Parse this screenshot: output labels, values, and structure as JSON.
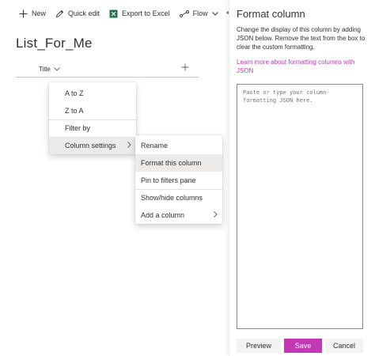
{
  "command_bar": {
    "new_label": "New",
    "quick_edit_label": "Quick edit",
    "export_label": "Export to Excel",
    "flow_label": "Flow",
    "icons": [
      "plus-icon",
      "pencil-icon",
      "excel-icon",
      "flow-icon",
      "chevron-down-icon",
      "more-icon"
    ]
  },
  "list": {
    "title": "List_For_Me",
    "column_header": "Title"
  },
  "column_menu": {
    "items": [
      {
        "label": "A to Z"
      },
      {
        "label": "Z to A"
      },
      {
        "label": "Filter by"
      },
      {
        "label": "Column settings",
        "highlighted": true,
        "has_submenu": true
      }
    ]
  },
  "settings_submenu": {
    "items": [
      {
        "label": "Rename"
      },
      {
        "label": "Format this column",
        "highlighted": true
      },
      {
        "label": "Pin to filters pane"
      },
      {
        "label": "Show/hide columns"
      },
      {
        "label": "Add a column",
        "has_submenu": true
      }
    ]
  },
  "panel": {
    "title": "Format column",
    "description": "Change the display of this column by adding JSON below. Remove the text from the box to clear the custom formatting.",
    "link": "Learn more about formatting columns with JSON",
    "json_placeholder": "Paste or type your column-formatting JSON here.",
    "json_value": "",
    "buttons": {
      "preview": "Preview",
      "save": "Save",
      "cancel": "Cancel"
    }
  },
  "colors": {
    "accent": "#c239b3",
    "text": "#323130",
    "highlight": "#edebe9",
    "excel_green": "#217346"
  }
}
